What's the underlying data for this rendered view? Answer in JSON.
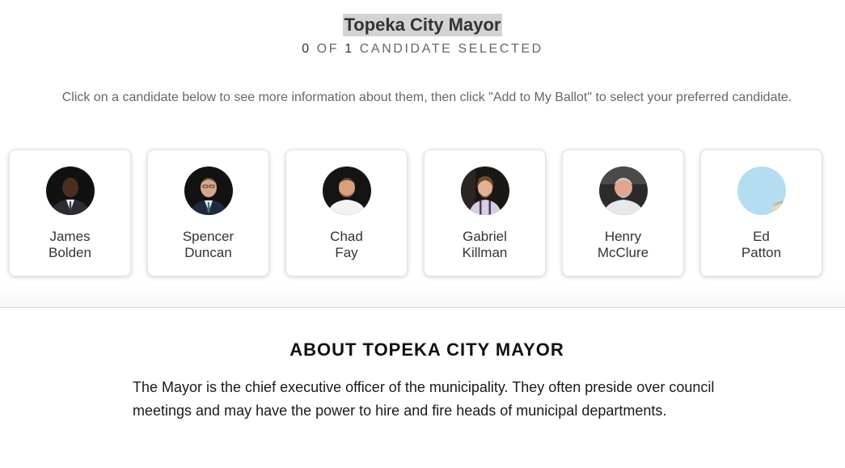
{
  "race": {
    "title": "Topeka City Mayor"
  },
  "selection": {
    "selected_count": "0",
    "of_label": "OF",
    "total_count": "1",
    "suffix_label": "CANDIDATE SELECTED"
  },
  "instructions": "Click on a candidate below to see more information about them, then click \"Add to My Ballot\" to select your preferred candidate.",
  "candidates": [
    {
      "first": "James",
      "last": "Bolden",
      "photo": "photo-icon"
    },
    {
      "first": "Spencer",
      "last": "Duncan",
      "photo": "photo-icon"
    },
    {
      "first": "Chad",
      "last": "Fay",
      "photo": "photo-icon"
    },
    {
      "first": "Gabriel",
      "last": "Killman",
      "photo": "photo-icon"
    },
    {
      "first": "Henry",
      "last": "McClure",
      "photo": "photo-icon"
    },
    {
      "first": "Ed",
      "last": "Patton",
      "photo": "placeholder-avatar-icon"
    }
  ],
  "about": {
    "title": "ABOUT TOPEKA CITY MAYOR",
    "description": "The Mayor is the chief executive officer of the municipality. They often preside over council meetings and may have the power to hire and fire heads of municipal departments."
  }
}
